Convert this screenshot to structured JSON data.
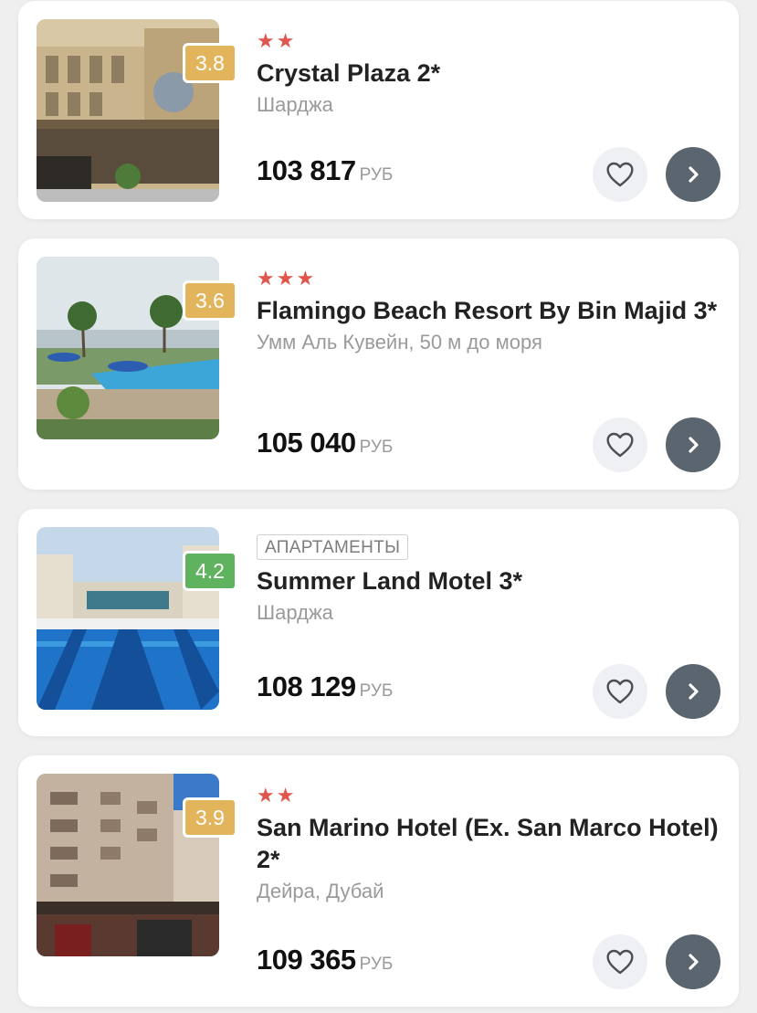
{
  "currency": "РУБ",
  "hotels": [
    {
      "stars": "★★",
      "tag": "",
      "rating": "3.8",
      "rating_color": "#e2b45c",
      "name": "Crystal Plaza 2*",
      "location": "Шарджа",
      "price": "103 817",
      "photo_icon": "hotel-building-photo"
    },
    {
      "stars": "★★★",
      "tag": "",
      "rating": "3.6",
      "rating_color": "#e2b45c",
      "name": "Flamingo Beach Resort By Bin Majid 3*",
      "location": "Умм Аль Кувейн, 50 м до моря",
      "price": "105 040",
      "photo_icon": "beach-pool-photo"
    },
    {
      "stars": "",
      "tag": "АПАРТАМЕНТЫ",
      "rating": "4.2",
      "rating_color": "#5fb35f",
      "name": "Summer Land Motel 3*",
      "location": "Шарджа",
      "price": "108 129",
      "photo_icon": "pool-photo"
    },
    {
      "stars": "★★",
      "tag": "",
      "rating": "3.9",
      "rating_color": "#e2b45c",
      "name": "San Marino Hotel (Ex. San Marco Hotel) 2*",
      "location": "Дейра, Дубай",
      "price": "109 365",
      "photo_icon": "street-building-photo"
    }
  ]
}
